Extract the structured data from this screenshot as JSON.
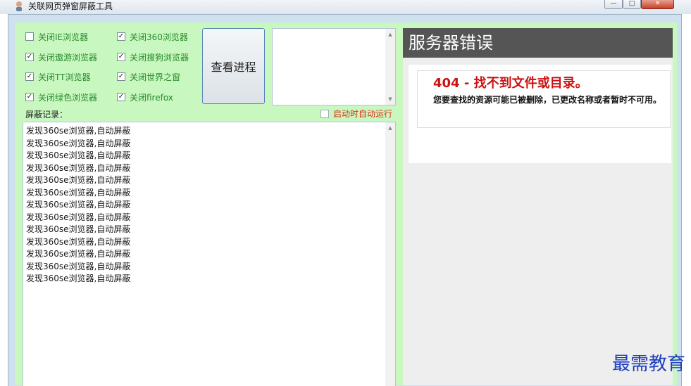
{
  "window": {
    "title": "关联网页弹窗屏蔽工具",
    "min_label": "—",
    "max_label": "□",
    "close_label": "✕"
  },
  "options": [
    {
      "label": "关闭IE浏览器",
      "checked": false
    },
    {
      "label": "关闭360浏览器",
      "checked": true
    },
    {
      "label": "关闭遨游浏览器",
      "checked": true
    },
    {
      "label": "关闭搜狗浏览器",
      "checked": true
    },
    {
      "label": "关闭TT浏览器",
      "checked": true
    },
    {
      "label": "关闭世界之窗",
      "checked": true
    },
    {
      "label": "关闭绿色浏览器",
      "checked": true
    },
    {
      "label": "关闭firefox",
      "checked": true
    }
  ],
  "view_process_button": "查看进程",
  "log": {
    "label": "屏蔽记录：",
    "lines": [
      "发现360se浏览器,自动屏蔽",
      "发现360se浏览器,自动屏蔽",
      "发现360se浏览器,自动屏蔽",
      "发现360se浏览器,自动屏蔽",
      "发现360se浏览器,自动屏蔽",
      "发现360se浏览器,自动屏蔽",
      "发现360se浏览器,自动屏蔽",
      "发现360se浏览器,自动屏蔽",
      "发现360se浏览器,自动屏蔽",
      "发现360se浏览器,自动屏蔽",
      "发现360se浏览器,自动屏蔽",
      "发现360se浏览器,自动屏蔽",
      "发现360se浏览器,自动屏蔽"
    ]
  },
  "autostart": {
    "label": "启动时自动运行",
    "checked": false
  },
  "web": {
    "header": "服务器错误",
    "error_title": "404 - 找不到文件或目录。",
    "error_desc": "您要查找的资源可能已被删除，已更改名称或者暂时不可用。"
  },
  "watermark": "最需教育",
  "colors": {
    "client_bg": "#c8f8c0",
    "error_red": "#cc1111",
    "header_gray": "#555555"
  }
}
